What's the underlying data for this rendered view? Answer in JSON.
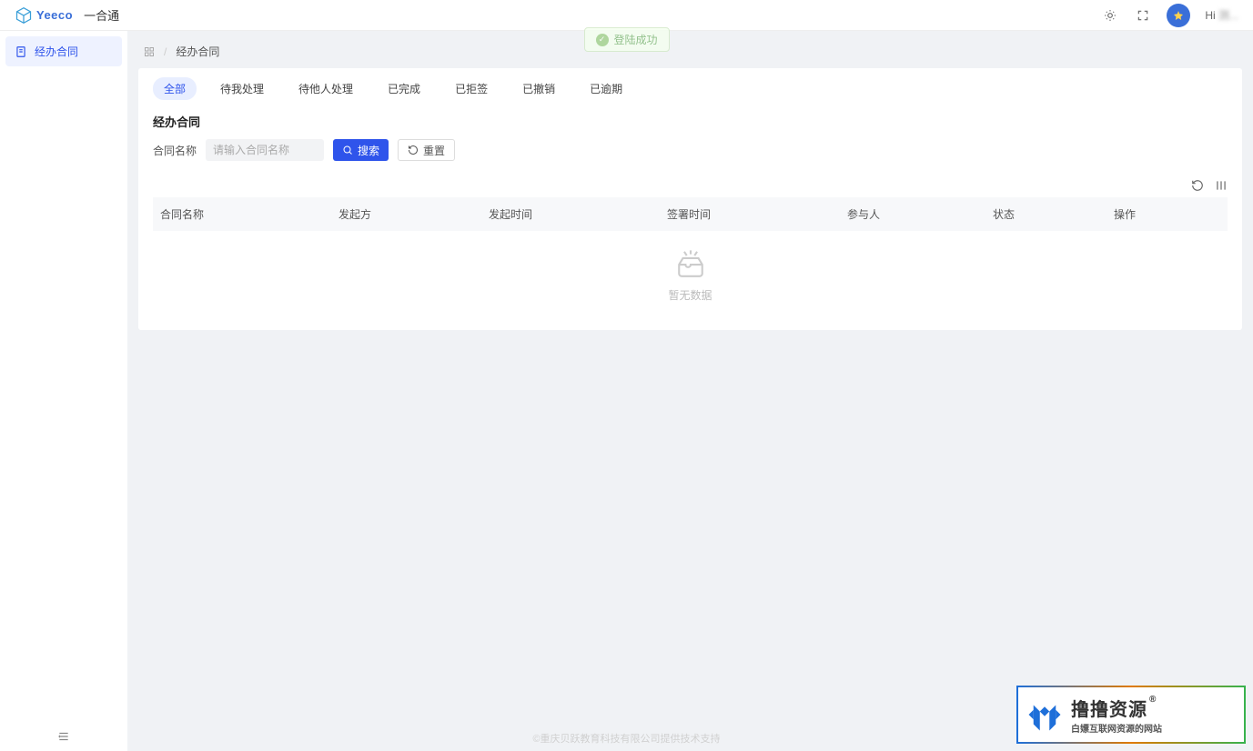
{
  "header": {
    "brand": "Yeeco",
    "app_title": "一合通",
    "greeting_prefix": "Hi ",
    "greeting_name": "测..."
  },
  "toast": {
    "text": "登陆成功"
  },
  "sidebar": {
    "items": [
      {
        "label": "经办合同"
      }
    ]
  },
  "breadcrumb": {
    "sep": "/",
    "current": "经办合同"
  },
  "tabs": [
    {
      "label": "全部",
      "active": true
    },
    {
      "label": "待我处理"
    },
    {
      "label": "待他人处理"
    },
    {
      "label": "已完成"
    },
    {
      "label": "已拒签"
    },
    {
      "label": "已撤销"
    },
    {
      "label": "已逾期"
    }
  ],
  "section_title": "经办合同",
  "filter": {
    "label": "合同名称",
    "placeholder": "请输入合同名称",
    "search_btn": "搜索",
    "reset_btn": "重置"
  },
  "table": {
    "columns": [
      "合同名称",
      "发起方",
      "发起时间",
      "签署时间",
      "参与人",
      "状态",
      "操作"
    ],
    "empty_text": "暂无数据"
  },
  "footer": "©重庆贝跃教育科技有限公司提供技术支持",
  "watermark": {
    "main": "撸撸资源",
    "sub": "白嫖互联网资源的网站"
  }
}
